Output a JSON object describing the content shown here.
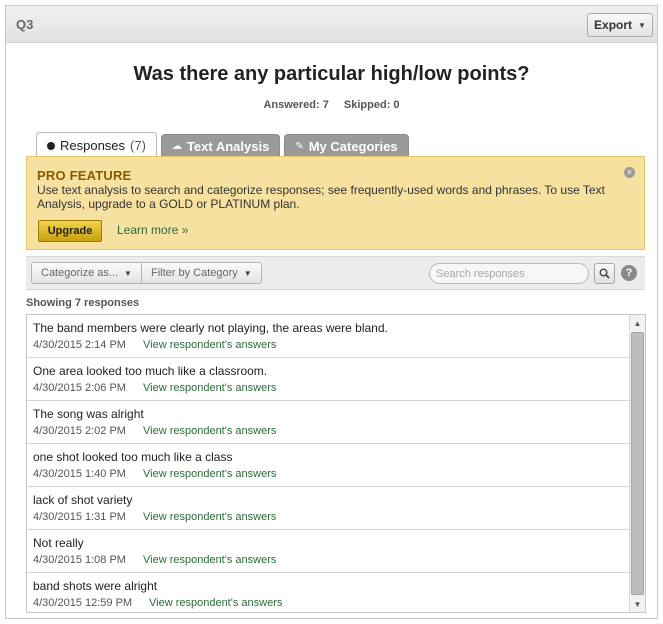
{
  "header": {
    "question_label": "Q3",
    "export_label": "Export"
  },
  "question": {
    "title": "Was there any particular high/low points?",
    "answered_label": "Answered: 7",
    "skipped_label": "Skipped: 0"
  },
  "tabs": [
    {
      "label": "Responses",
      "count": "(7)",
      "icon": "bullet-icon",
      "active": true
    },
    {
      "label": "Text Analysis",
      "icon": "cloud-icon",
      "active": false
    },
    {
      "label": "My Categories",
      "icon": "tag-icon",
      "active": false
    }
  ],
  "promo": {
    "title": "PRO FEATURE",
    "text": "Use text analysis to search and categorize responses; see frequently-used words and phrases. To use Text Analysis, upgrade to a GOLD or PLATINUM plan.",
    "upgrade_label": "Upgrade",
    "learn_more_label": "Learn more »",
    "close_icon": "×",
    "color": "#f7e1a0"
  },
  "toolbar": {
    "categorize_label": "Categorize as...",
    "filter_label": "Filter by Category",
    "search_placeholder": "Search responses",
    "help_label": "?"
  },
  "showing_label": "Showing 7 responses",
  "responses": [
    {
      "text": "The band members were clearly not playing, the areas were bland.",
      "date": "4/30/2015 2:14 PM",
      "link": "View respondent's answers"
    },
    {
      "text": "One area looked too much like a classroom.",
      "date": "4/30/2015 2:06 PM",
      "link": "View respondent's answers"
    },
    {
      "text": "The song was alright",
      "date": "4/30/2015 2:02 PM",
      "link": "View respondent's answers"
    },
    {
      "text": "one shot looked too much like a class",
      "date": "4/30/2015 1:40 PM",
      "link": "View respondent's answers"
    },
    {
      "text": "lack of shot variety",
      "date": "4/30/2015 1:31 PM",
      "link": "View respondent's answers"
    },
    {
      "text": "Not really",
      "date": "4/30/2015 1:08 PM",
      "link": "View respondent's answers"
    },
    {
      "text": "band shots were alright",
      "date": "4/30/2015 12:59 PM",
      "link": "View respondent's answers"
    }
  ],
  "colors": {
    "link": "#2b6c3b",
    "upgrade": "#e1bf26",
    "inactive_tab": "#9a9a9a"
  }
}
